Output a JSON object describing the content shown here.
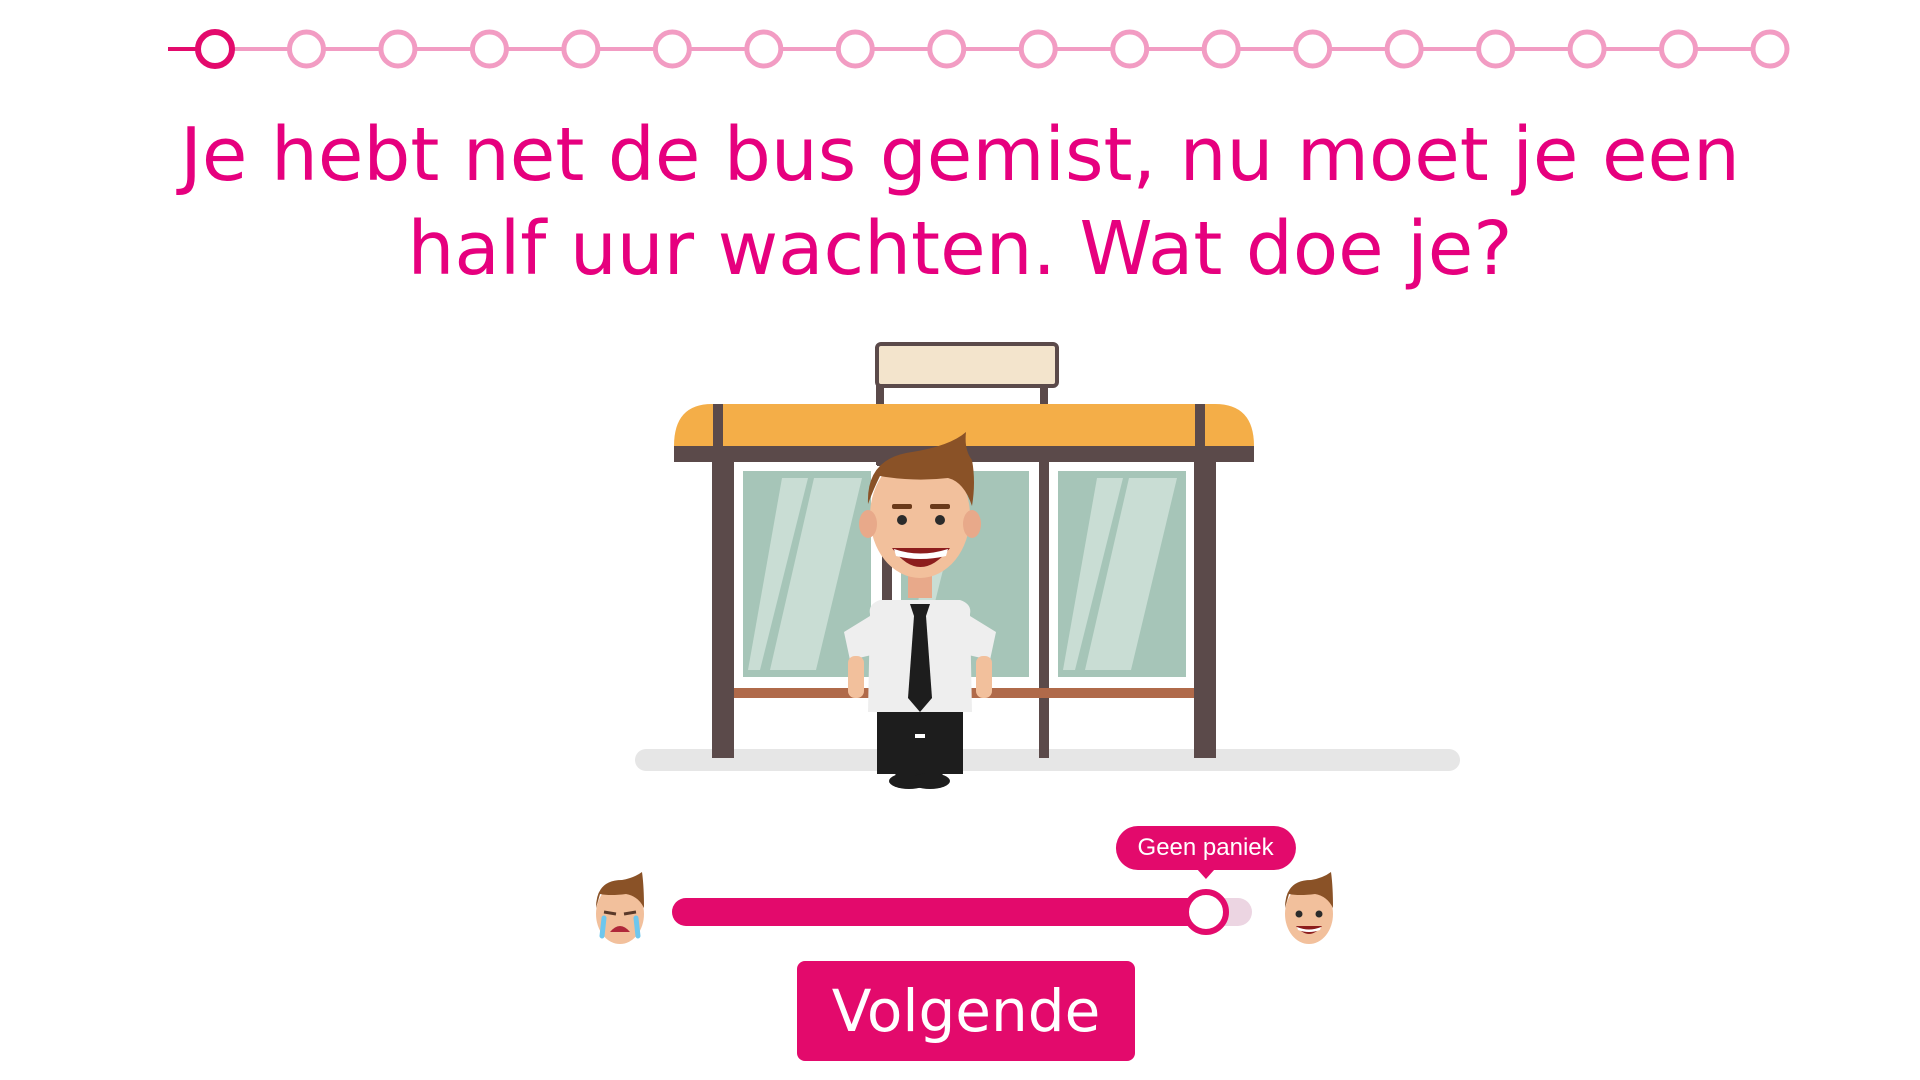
{
  "progress": {
    "total_steps": 18,
    "current_step": 1
  },
  "question": "Je hebt net de bus gemist, nu moet je een half uur wachten. Wat doe je?",
  "slider": {
    "value": 0.92,
    "tooltip": "Geen paniek",
    "left_icon": "crying-face-icon",
    "right_icon": "smiling-face-icon"
  },
  "next_button": {
    "label": "Volgende"
  },
  "colors": {
    "accent": "#e30a6c",
    "progress_line": "#f29cc3",
    "roof": "#f4ae48",
    "frame": "#5b4a4a",
    "glass": "#a6c5b8"
  }
}
